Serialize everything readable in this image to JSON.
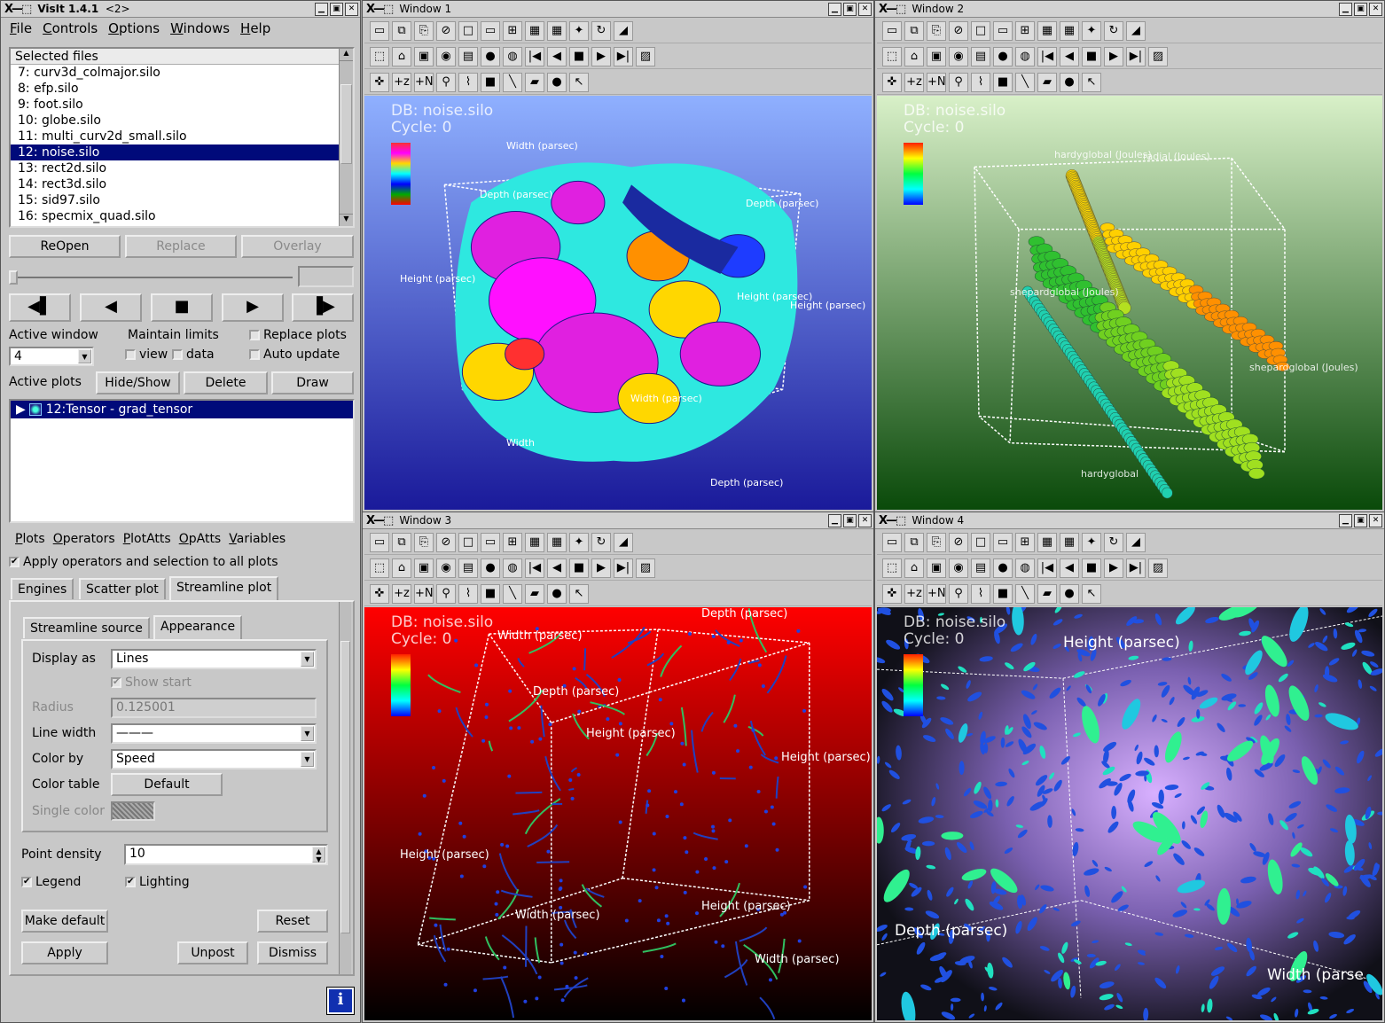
{
  "main": {
    "logo": "X—⬚",
    "title": "VisIt 1.4.1",
    "suffix": "<2>",
    "menus": [
      "File",
      "Controls",
      "Options",
      "Windows",
      "Help"
    ],
    "files_header": "Selected files",
    "files": [
      "7: curv3d_colmajor.silo",
      "8: efp.silo",
      "9: foot.silo",
      "10: globe.silo",
      "11: multi_curv2d_small.silo",
      "12: noise.silo",
      "13: rect2d.silo",
      "14: rect3d.silo",
      "15: sid97.silo",
      "16: specmix_quad.silo"
    ],
    "selected_file": 5,
    "reopen": "ReOpen",
    "replace": "Replace",
    "overlay": "Overlay",
    "active_window_label": "Active window",
    "active_window_value": "4",
    "maintain_limits": "Maintain limits",
    "view": "view",
    "data": "data",
    "replace_plots": "Replace plots",
    "auto_update": "Auto update",
    "active_plots": "Active plots",
    "hide_show": "Hide/Show",
    "delete": "Delete",
    "draw": "Draw",
    "plot_item": "12:Tensor - grad_tensor",
    "bottom_menu": [
      "Plots",
      "Operators",
      "PlotAtts",
      "OpAtts",
      "Variables"
    ],
    "apply_all": "Apply operators and selection to all plots",
    "tabs": [
      "Engines",
      "Scatter plot",
      "Streamline plot"
    ],
    "subtabs": [
      "Streamline source",
      "Appearance"
    ],
    "display_as_label": "Display as",
    "display_as_value": "Lines",
    "show_start": "Show start",
    "radius_label": "Radius",
    "radius_value": "0.125001",
    "line_width_label": "Line width",
    "line_width_value": "———",
    "color_by_label": "Color by",
    "color_by_value": "Speed",
    "color_table_label": "Color table",
    "color_table_value": "Default",
    "single_color_label": "Single color",
    "point_density_label": "Point density",
    "point_density_value": "10",
    "legend": "Legend",
    "lighting": "Lighting",
    "make_default": "Make default",
    "reset": "Reset",
    "apply": "Apply",
    "unpost": "Unpost",
    "dismiss": "Dismiss"
  },
  "windows": [
    {
      "title": "Window 1",
      "db": "DB: noise.silo",
      "cycle": "Cycle: 0",
      "bg_top": "#8fb0ff",
      "bg_bottom": "#1a1a9a",
      "axis_labels": [
        "Width (parsec)",
        "Depth (parsec)",
        "Height (parsec)",
        "Height (parsec)",
        "Depth (parsec)",
        "Width (parsec)",
        "Depth (parsec)",
        "Height (parsec)",
        "Width"
      ]
    },
    {
      "title": "Window 2",
      "db": "DB: noise.silo",
      "cycle": "Cycle: 0",
      "bg_top": "#d8f0c8",
      "bg_bottom": "#0a4a0a",
      "axis_labels": [
        "hardyglobal (Joules)",
        "radial (Joules)",
        "shepardglobal (Joules)",
        "shepardglobal (Joules)",
        "hardyglobal"
      ]
    },
    {
      "title": "Window 3",
      "db": "DB: noise.silo",
      "cycle": "Cycle: 0",
      "bg_top": "#ff0000",
      "bg_bottom": "#000000",
      "axis_labels": [
        "Width (parsec)",
        "Depth (parsec)",
        "Depth (parsec)",
        "Height (parsec)",
        "Height (parsec)",
        "Height (parsec)",
        "Width (parsec)",
        "Height (parsec)",
        "Width (parsec)"
      ]
    },
    {
      "title": "Window 4",
      "db": "DB: noise.silo",
      "cycle": "Cycle: 0",
      "bg_top": "#d8b8ff",
      "bg_bottom": "#000000",
      "axis_labels": [
        "Height (parsec)",
        "Depth (parsec)",
        "Width (parse"
      ]
    }
  ]
}
